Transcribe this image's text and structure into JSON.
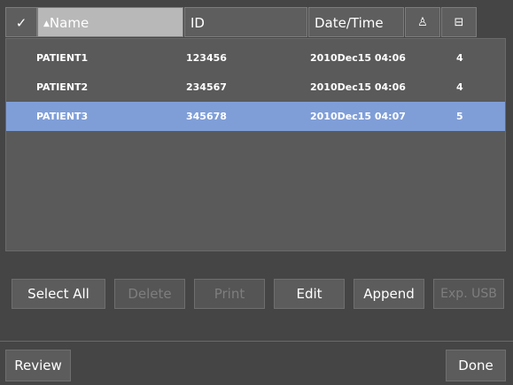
{
  "header": {
    "check_icon": "✓",
    "name_label": "Name",
    "sort_icon": "▲",
    "id_label": "ID",
    "date_label": "Date/Time",
    "person_icon": "♙",
    "disk_icon": "⊟"
  },
  "rows": [
    {
      "name": "PATIENT1",
      "id": "123456",
      "date": "2010Dec15 04:06",
      "count": "4"
    },
    {
      "name": "PATIENT2",
      "id": "234567",
      "date": "2010Dec15 04:06",
      "count": "4"
    },
    {
      "name": "PATIENT3",
      "id": "345678",
      "date": "2010Dec15 04:07",
      "count": "5"
    }
  ],
  "selected_row": "PATIENT3",
  "buttons": {
    "select_all": "Select All",
    "delete": "Delete",
    "print": "Print",
    "edit": "Edit",
    "append": "Append",
    "exp_usb": "Exp. USB",
    "review": "Review",
    "done": "Done"
  },
  "colors": {
    "selected_row": "#7f9ed8",
    "panel_bg": "#454545",
    "disabled_text": "#7e7e7e"
  }
}
